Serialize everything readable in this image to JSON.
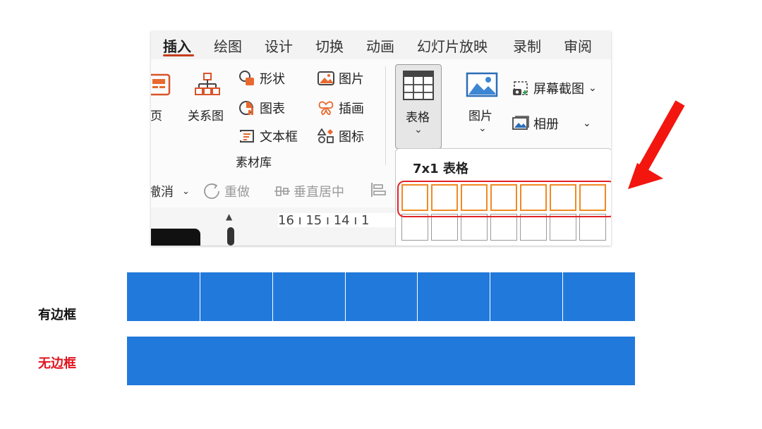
{
  "ribbon": {
    "tabs": [
      "插入",
      "绘图",
      "设计",
      "切换",
      "动画",
      "幻灯片放映",
      "录制",
      "审阅"
    ],
    "active_tab": "插入",
    "groups": {
      "page_label_partial": "单页",
      "smartart_label": "关系图",
      "shapes_label": "形状",
      "chart_label": "图表",
      "textbox_label": "文本框",
      "assets_group_label": "素材库",
      "picture_label": "图片",
      "illustration_label": "插画",
      "icon_label": "图标",
      "table_label": "表格",
      "picture_big_label": "图片",
      "screenshot_label": "屏幕截图",
      "album_label": "相册"
    },
    "toolbar2": {
      "undo_label": "撤消",
      "redo_label": "重做",
      "vcenter_label": "垂直居中"
    },
    "ruler_text": "16 ı 15 ı 14 ı 1"
  },
  "table_dropdown": {
    "title": "7x1 表格",
    "columns": 7,
    "selected_rows": 1
  },
  "examples": {
    "bordered_label": "有边框",
    "borderless_label": "无边框",
    "table_color": "#2179dc",
    "bordered_label_color": "#111111",
    "borderless_label_color": "#e0141e"
  },
  "colors": {
    "accent_orange": "#f08a24",
    "highlight_red": "#e0242a",
    "arrow_red": "#f2160f",
    "ribbon_accent": "#c43e1c"
  }
}
